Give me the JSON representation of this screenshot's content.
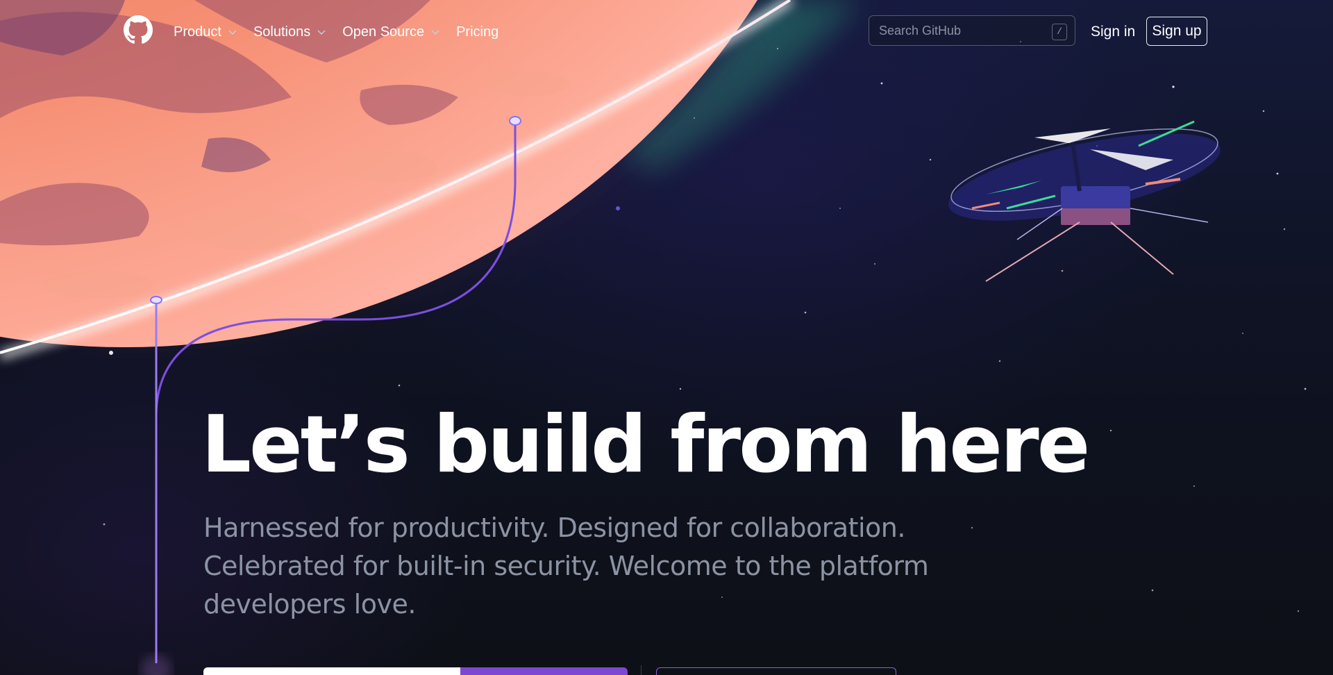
{
  "header": {
    "logo_icon": "github-mark-icon",
    "nav": [
      {
        "label": "Product",
        "has_dropdown": true
      },
      {
        "label": "Solutions",
        "has_dropdown": true
      },
      {
        "label": "Open Source",
        "has_dropdown": true
      },
      {
        "label": "Pricing",
        "has_dropdown": false
      }
    ],
    "search": {
      "placeholder": "Search GitHub",
      "value": "",
      "shortcut": "/"
    },
    "sign_in": "Sign in",
    "sign_up": "Sign up"
  },
  "hero": {
    "title": "Let’s build from here",
    "subtitle": "Harnessed for productivity. Designed for collaboration. Celebrated for built-in security. Welcome to the platform developers love."
  },
  "colors": {
    "background": "#0d1117",
    "planet": "#e97a5a",
    "accent_purple": "#7d47d4",
    "subtitle_gray": "#8c93a3"
  }
}
